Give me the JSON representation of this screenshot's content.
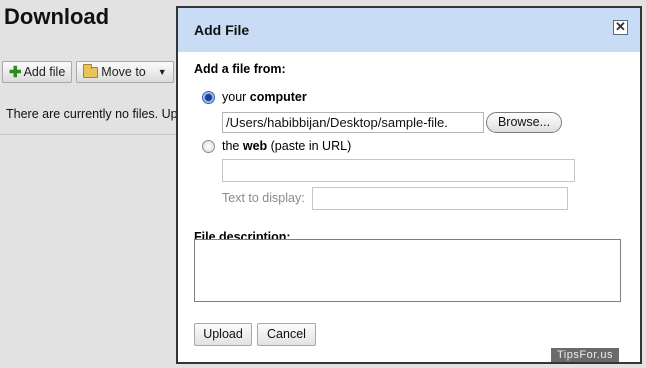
{
  "background": {
    "title": "Download",
    "toolbar": {
      "add_file_label": "Add file",
      "move_to_label": "Move to",
      "move_to_caret": "▼"
    },
    "message": "There are currently no files. Uplo"
  },
  "dialog": {
    "title": "Add File",
    "close_glyph": "✕",
    "add_from_label": "Add a file from:",
    "option_computer": {
      "prefix": "your ",
      "bold": "computer",
      "selected": true
    },
    "file_path_value": "/Users/habibbijan/Desktop/sample-file.",
    "browse_label": "Browse...",
    "option_web": {
      "prefix": "the ",
      "bold": "web",
      "suffix": " (paste in URL)",
      "selected": false
    },
    "url_value": "",
    "text_to_display_label": "Text to display:",
    "text_to_display_value": "",
    "file_description_label": "File description:",
    "file_description_value": "",
    "upload_label": "Upload",
    "cancel_label": "Cancel"
  },
  "watermark": "TipsFor.us",
  "colors": {
    "dialog_header": "#c9dcf5",
    "page_background": "#e2e2e2",
    "add_icon": "#2d8a1e"
  }
}
